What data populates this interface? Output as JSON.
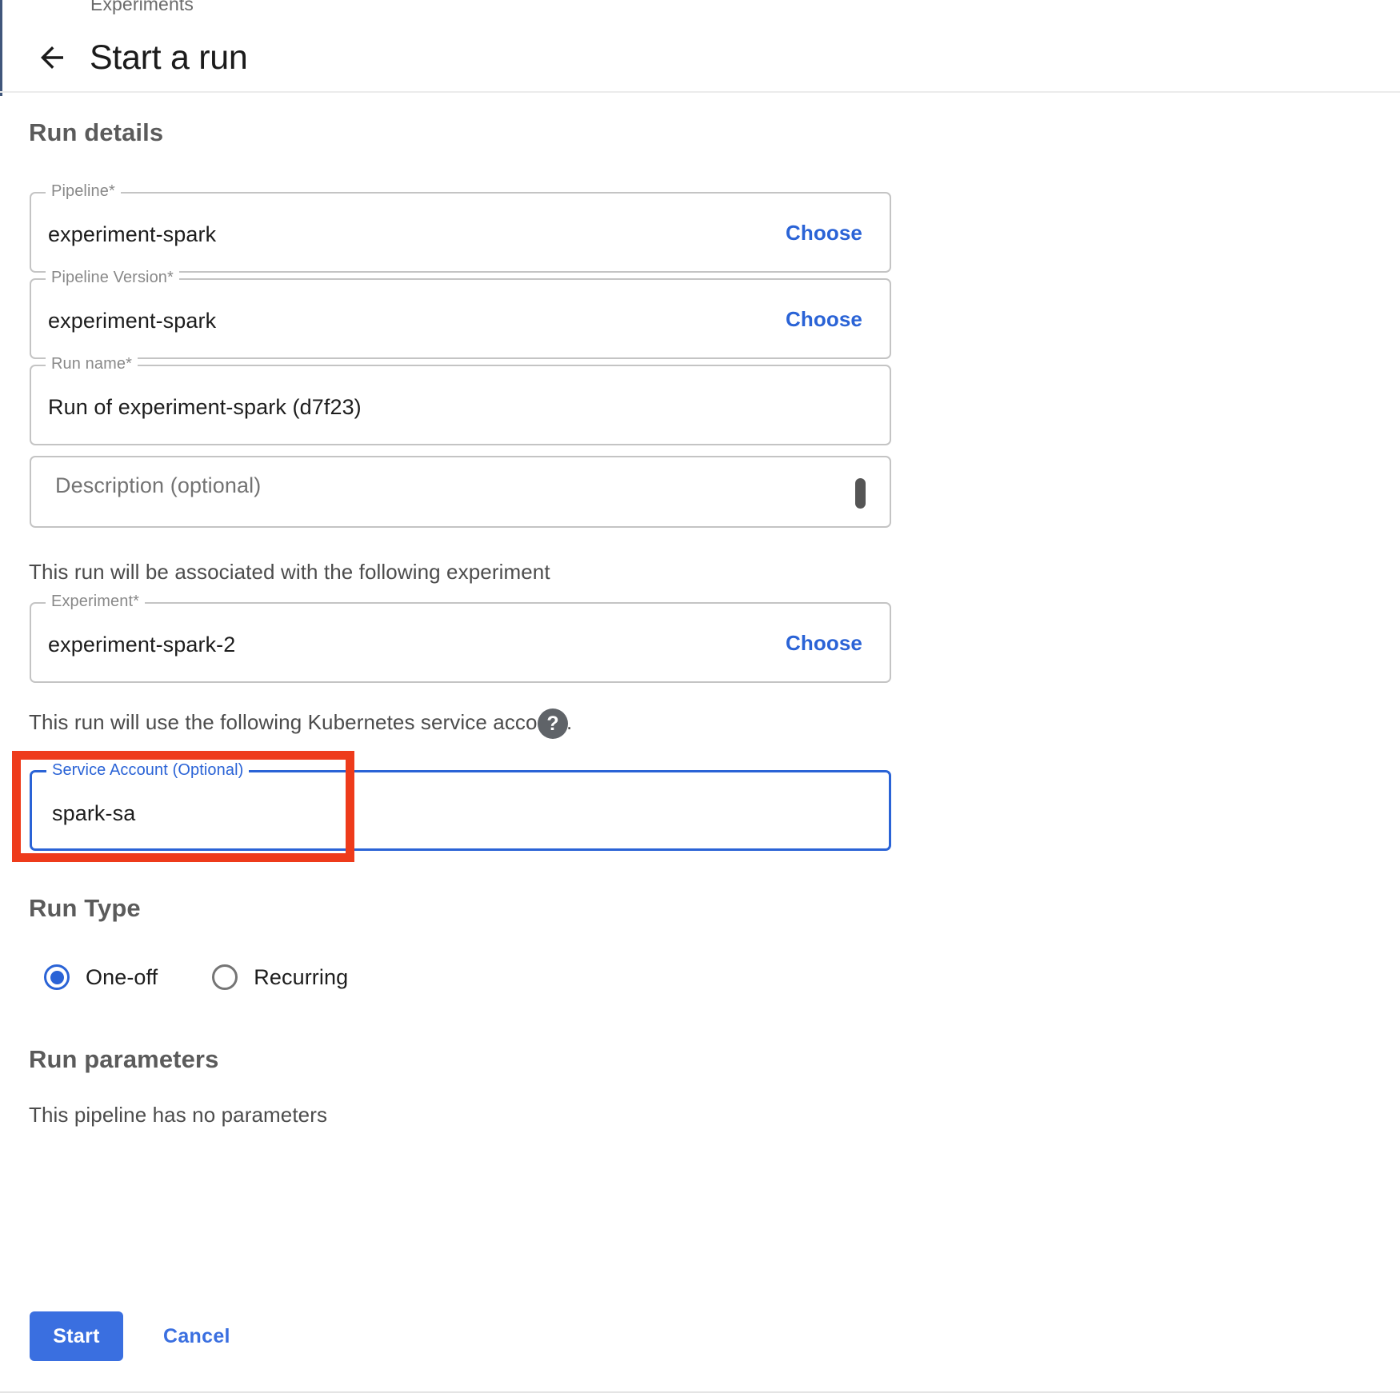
{
  "breadcrumb": {
    "label": "Experiments"
  },
  "header": {
    "back_icon": "arrow-left-icon",
    "title": "Start a run"
  },
  "sections": {
    "run_details_heading": "Run details",
    "run_type_heading": "Run Type",
    "run_parameters_heading": "Run parameters"
  },
  "fields": {
    "pipeline": {
      "label": "Pipeline*",
      "value": "experiment-spark",
      "action_label": "Choose"
    },
    "pipeline_version": {
      "label": "Pipeline Version*",
      "value": "experiment-spark",
      "action_label": "Choose"
    },
    "run_name": {
      "label": "Run name*",
      "value": "Run of experiment-spark (d7f23)"
    },
    "description": {
      "placeholder": "Description (optional)",
      "value": ""
    },
    "experiment": {
      "label": "Experiment*",
      "value": "experiment-spark-2",
      "action_label": "Choose"
    },
    "service_account": {
      "label": "Service Account (Optional)",
      "value": "spark-sa",
      "focused": true,
      "highlighted": true
    }
  },
  "notes": {
    "experiment_note": "This run will be associated with the following experiment",
    "ksa_note": "This run will use the following Kubernetes service account.",
    "help_icon_glyph": "?",
    "no_parameters": "This pipeline has no parameters"
  },
  "run_type": {
    "options": [
      {
        "label": "One-off",
        "selected": true
      },
      {
        "label": "Recurring",
        "selected": false
      }
    ]
  },
  "actions": {
    "start_label": "Start",
    "cancel_label": "Cancel"
  },
  "colors": {
    "accent_blue": "#2a63d6",
    "button_blue": "#3a6fe0",
    "annotation_red": "#ee3b1b",
    "field_border": "#c4c4c4",
    "heading_gray": "#5b5b5b",
    "label_gray": "#898989"
  }
}
